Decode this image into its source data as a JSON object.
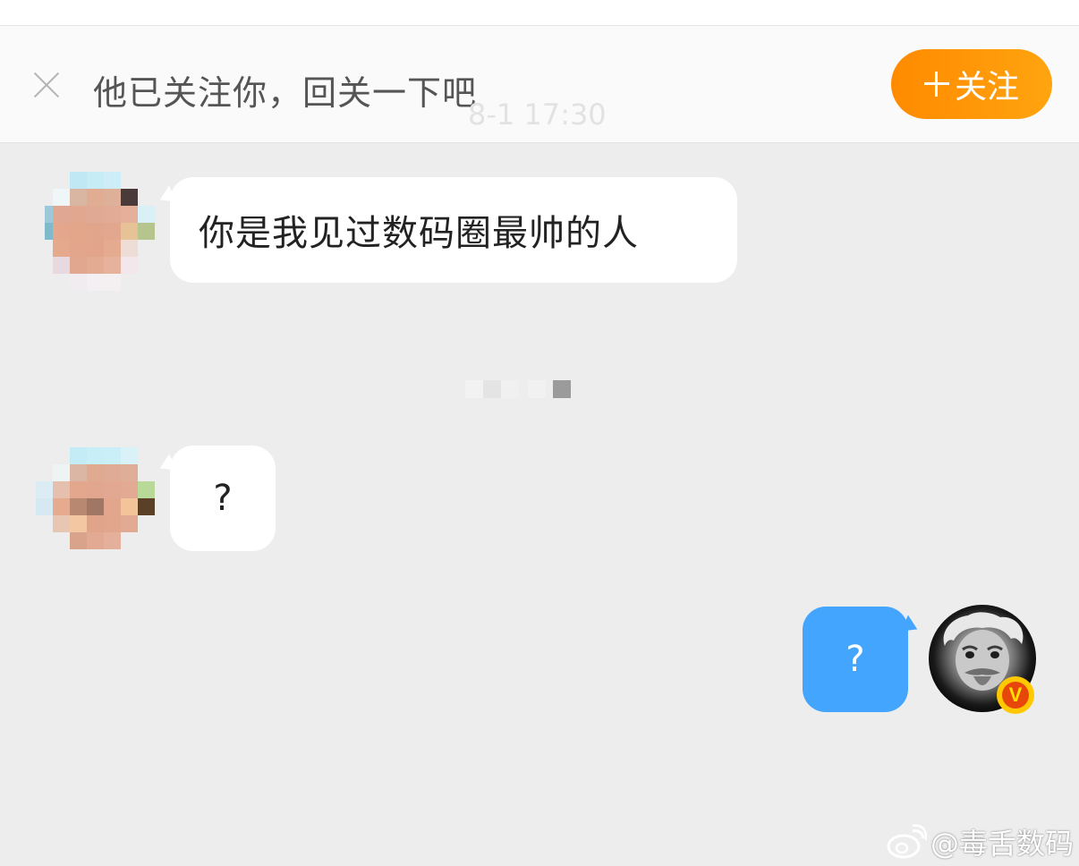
{
  "banner": {
    "prompt_text": "他已关注你，回关一下吧",
    "ghost_timestamp": "8-1 17:30",
    "follow_button_label": "+关注",
    "follow_button_text": "关注"
  },
  "messages": [
    {
      "sender": "other",
      "text": "你是我见过数码圈最帅的人"
    },
    {
      "sender": "other",
      "text": "?"
    },
    {
      "sender": "me",
      "text": "?"
    }
  ],
  "me": {
    "verified_badge": "V"
  },
  "watermark": {
    "text": "@毒舌数码"
  },
  "colors": {
    "chat_background": "#ededed",
    "follow_button": "#ff9505",
    "my_bubble": "#44a5ff",
    "other_bubble": "#ffffff"
  },
  "icons": [
    "close-icon",
    "plus-icon",
    "verified-v-icon",
    "weibo-logo-icon"
  ]
}
